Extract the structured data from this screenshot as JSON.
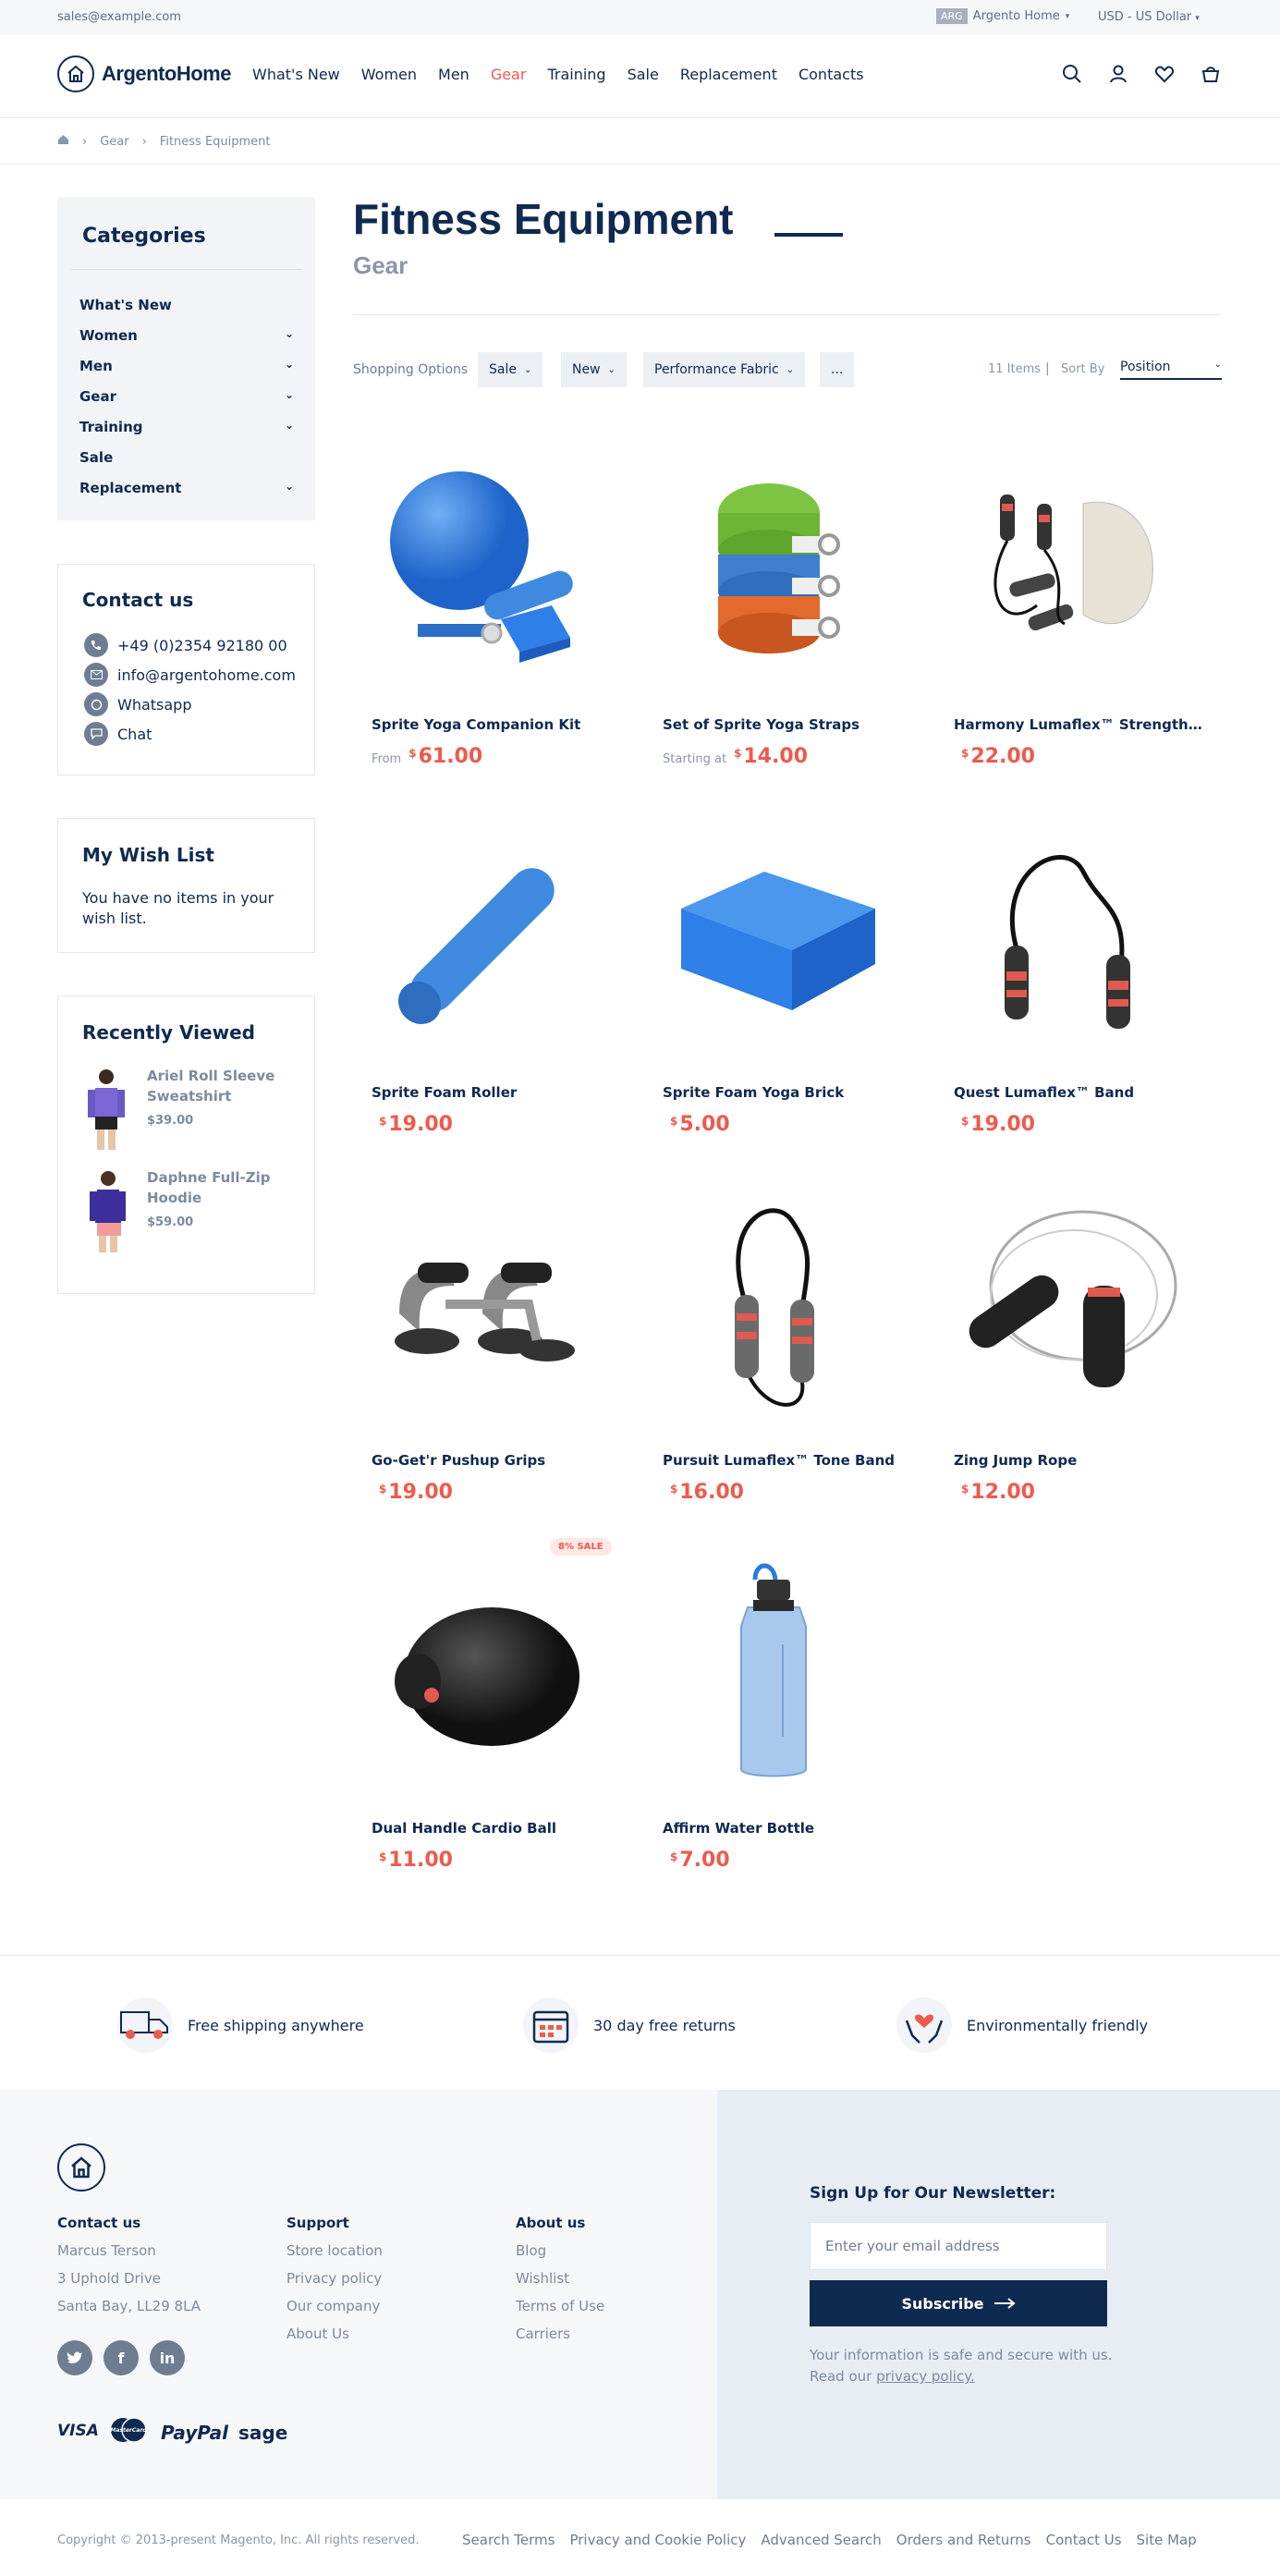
{
  "topbar": {
    "email": "sales@example.com",
    "store_code": "ARG",
    "store_name": "Argento Home",
    "currency": "USD - US Dollar"
  },
  "header": {
    "logo_text": "ArgentoHome",
    "nav": [
      {
        "label": "What's New",
        "active": false
      },
      {
        "label": "Women",
        "active": false
      },
      {
        "label": "Men",
        "active": false
      },
      {
        "label": "Gear",
        "active": true
      },
      {
        "label": "Training",
        "active": false
      },
      {
        "label": "Sale",
        "active": false
      },
      {
        "label": "Replacement",
        "active": false
      },
      {
        "label": "Contacts",
        "active": false
      }
    ],
    "icons": [
      "search-icon",
      "account-icon",
      "wishlist-icon",
      "cart-icon"
    ]
  },
  "breadcrumb": [
    "Gear",
    "Fitness Equipment"
  ],
  "sidebar": {
    "categories_title": "Categories",
    "categories": [
      {
        "label": "What's New",
        "has_children": false
      },
      {
        "label": "Women",
        "has_children": true
      },
      {
        "label": "Men",
        "has_children": true
      },
      {
        "label": "Gear",
        "has_children": true
      },
      {
        "label": "Training",
        "has_children": true
      },
      {
        "label": "Sale",
        "has_children": false
      },
      {
        "label": "Replacement",
        "has_children": true
      }
    ],
    "contact_title": "Contact us",
    "contacts": [
      {
        "icon": "phone-icon",
        "label": "+49 (0)2354 92180 00"
      },
      {
        "icon": "mail-icon",
        "label": "info@argentohome.com"
      },
      {
        "icon": "whatsapp-icon",
        "label": "Whatsapp"
      },
      {
        "icon": "chat-icon",
        "label": "Chat"
      }
    ],
    "wishlist_title": "My Wish List",
    "wishlist_text": "You have no items in your wish list.",
    "recent_title": "Recently Viewed",
    "recent": [
      {
        "name": "Ariel Roll Sleeve Sweatshirt",
        "price": "$39.00"
      },
      {
        "name": "Daphne Full-Zip Hoodie",
        "price": "$59.00"
      }
    ]
  },
  "main": {
    "title": "Fitness Equipment",
    "subtitle": "Gear",
    "toolbar": {
      "label": "Shopping Options",
      "filters": [
        "Sale",
        "New",
        "Performance Fabric",
        "..."
      ],
      "count": "11 Items",
      "separator": "|",
      "sort_label": "Sort By",
      "sort_value": "Position"
    },
    "products": [
      {
        "name": "Sprite Yoga Companion Kit",
        "prefix": "From",
        "price": "61.00",
        "image": "yoga-kit"
      },
      {
        "name": "Set of Sprite Yoga Straps",
        "prefix": "Starting at",
        "price": "14.00",
        "image": "yoga-straps"
      },
      {
        "name": "Harmony Lumaflex™ Strength Band Kit",
        "prefix": "",
        "price": "22.00",
        "image": "band-kit"
      },
      {
        "name": "Sprite Foam Roller",
        "prefix": "",
        "price": "19.00",
        "image": "foam-roller"
      },
      {
        "name": "Sprite Foam Yoga Brick",
        "prefix": "",
        "price": "5.00",
        "image": "yoga-brick"
      },
      {
        "name": "Quest Lumaflex™ Band",
        "prefix": "",
        "price": "19.00",
        "image": "quest-band"
      },
      {
        "name": "Go-Get'r Pushup Grips",
        "prefix": "",
        "price": "19.00",
        "image": "pushup-grips"
      },
      {
        "name": "Pursuit Lumaflex™ Tone Band",
        "prefix": "",
        "price": "16.00",
        "image": "tone-band"
      },
      {
        "name": "Zing Jump Rope",
        "prefix": "",
        "price": "12.00",
        "image": "jump-rope"
      },
      {
        "name": "Dual Handle Cardio Ball",
        "prefix": "",
        "price": "11.00",
        "image": "cardio-ball",
        "badge": "8% SALE"
      },
      {
        "name": "Affirm Water Bottle",
        "prefix": "",
        "price": "7.00",
        "image": "water-bottle"
      }
    ],
    "currency_symbol": "$"
  },
  "features": [
    {
      "icon": "truck-icon",
      "label": "Free shipping anywhere"
    },
    {
      "icon": "calendar-icon",
      "label": "30 day free returns"
    },
    {
      "icon": "eco-hands-icon",
      "label": "Environmentally friendly"
    }
  ],
  "footer": {
    "columns": [
      {
        "title": "Contact us",
        "links": [
          "Marcus Terson",
          "3 Uphold Drive",
          "Santa Bay, LL29 8LA"
        ]
      },
      {
        "title": "Support",
        "links": [
          "Store location",
          "Privacy policy",
          "Our company",
          "About Us"
        ]
      },
      {
        "title": "About us",
        "links": [
          "Blog",
          "Wishlist",
          "Terms of Use",
          "Carriers"
        ]
      }
    ],
    "social": [
      "twitter-icon",
      "facebook-icon",
      "linkedin-icon"
    ],
    "payments": [
      "VISA",
      "MasterCard",
      "PayPal",
      "sage"
    ],
    "newsletter": {
      "title": "Sign Up for Our Newsletter:",
      "placeholder": "Enter your email address",
      "button": "Subscribe",
      "note_prefix": "Your information is safe and secure with us. Read our",
      "note_link": "privacy policy."
    },
    "copyright": "Copyright © 2013-present Magento, Inc. All rights reserved.",
    "bottom_links": [
      "Search Terms",
      "Privacy and Cookie Policy",
      "Advanced Search",
      "Orders and Returns",
      "Contact Us",
      "Site Map"
    ]
  },
  "colors": {
    "brand": "#0f2a50",
    "accent": "#ee5a4e",
    "muted": "#7b8ba0"
  }
}
